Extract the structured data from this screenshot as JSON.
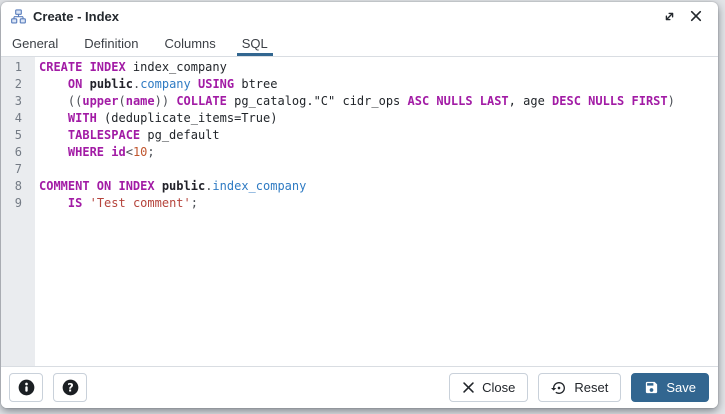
{
  "window": {
    "title": "Create - Index"
  },
  "tabs": [
    {
      "label": "General",
      "active": false
    },
    {
      "label": "Definition",
      "active": false
    },
    {
      "label": "Columns",
      "active": false
    },
    {
      "label": "SQL",
      "active": true
    }
  ],
  "editor": {
    "language": "SQL",
    "lines": [
      {
        "num": 1,
        "tokens": [
          {
            "c": "kw",
            "t": "CREATE INDEX"
          },
          {
            "c": "txt",
            "t": " index_company"
          }
        ]
      },
      {
        "num": 2,
        "tokens": [
          {
            "c": "txt",
            "t": "    "
          },
          {
            "c": "kw",
            "t": "ON"
          },
          {
            "c": "txt",
            "t": " "
          },
          {
            "c": "obj",
            "t": "public"
          },
          {
            "c": "pun",
            "t": "."
          },
          {
            "c": "id",
            "t": "company"
          },
          {
            "c": "txt",
            "t": " "
          },
          {
            "c": "kw",
            "t": "USING"
          },
          {
            "c": "txt",
            "t": " btree"
          }
        ]
      },
      {
        "num": 3,
        "tokens": [
          {
            "c": "pun",
            "t": "    (("
          },
          {
            "c": "kw",
            "t": "upper"
          },
          {
            "c": "pun",
            "t": "("
          },
          {
            "c": "kw",
            "t": "name"
          },
          {
            "c": "pun",
            "t": "))"
          },
          {
            "c": "txt",
            "t": " "
          },
          {
            "c": "kw",
            "t": "COLLATE"
          },
          {
            "c": "txt",
            "t": " pg_catalog.\"C\" cidr_ops "
          },
          {
            "c": "kw",
            "t": "ASC NULLS LAST"
          },
          {
            "c": "txt",
            "t": ", age "
          },
          {
            "c": "kw",
            "t": "DESC NULLS FIRST"
          },
          {
            "c": "pun",
            "t": ")"
          }
        ]
      },
      {
        "num": 4,
        "tokens": [
          {
            "c": "txt",
            "t": "    "
          },
          {
            "c": "kw",
            "t": "WITH"
          },
          {
            "c": "txt",
            "t": " (deduplicate_items=True)"
          }
        ]
      },
      {
        "num": 5,
        "tokens": [
          {
            "c": "txt",
            "t": "    "
          },
          {
            "c": "kw",
            "t": "TABLESPACE"
          },
          {
            "c": "txt",
            "t": " pg_default"
          }
        ]
      },
      {
        "num": 6,
        "tokens": [
          {
            "c": "txt",
            "t": "    "
          },
          {
            "c": "kw",
            "t": "WHERE"
          },
          {
            "c": "txt",
            "t": " "
          },
          {
            "c": "kw",
            "t": "id"
          },
          {
            "c": "pun",
            "t": "<"
          },
          {
            "c": "num",
            "t": "10"
          },
          {
            "c": "pun",
            "t": ";"
          }
        ]
      },
      {
        "num": 7,
        "tokens": []
      },
      {
        "num": 8,
        "tokens": [
          {
            "c": "kw",
            "t": "COMMENT ON INDEX"
          },
          {
            "c": "txt",
            "t": " "
          },
          {
            "c": "obj",
            "t": "public"
          },
          {
            "c": "pun",
            "t": "."
          },
          {
            "c": "id",
            "t": "index_company"
          }
        ]
      },
      {
        "num": 9,
        "tokens": [
          {
            "c": "txt",
            "t": "    "
          },
          {
            "c": "kw",
            "t": "IS"
          },
          {
            "c": "txt",
            "t": " "
          },
          {
            "c": "str",
            "t": "'Test comment'"
          },
          {
            "c": "pun",
            "t": ";"
          }
        ]
      }
    ]
  },
  "footer": {
    "close_label": "Close",
    "reset_label": "Reset",
    "save_label": "Save"
  },
  "icons": {
    "title": "index-sitemap-icon",
    "maximize": "maximize-icon",
    "close_window": "close-icon",
    "info": "info-icon",
    "help": "help-icon",
    "close_btn": "x-icon",
    "reset_btn": "restore-icon",
    "save_btn": "floppy-disk-icon"
  },
  "colors": {
    "accent": "#326690",
    "keyword": "#a21ba5",
    "identifier": "#2f7bc3",
    "string": "#b5443c",
    "number": "#c0562e",
    "gutter_bg": "#eaecef"
  }
}
